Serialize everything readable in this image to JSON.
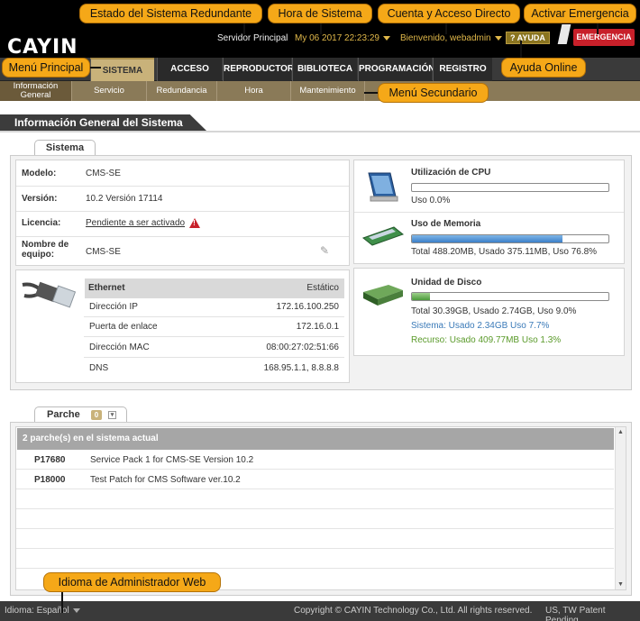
{
  "header": {
    "logo_text": "CAYIN",
    "server": "Servidor Principal",
    "datetime": "My 06 2017 22:23:29",
    "welcome": "Bienvenido, webadmin",
    "help": "AYUDA",
    "emergency": "EMERGENCIA"
  },
  "main_menu": [
    "SISTEMA",
    "ACCESO",
    "REPRODUCTOR",
    "BIBLIOTECA",
    "PROGRAMACIÓN",
    "REGISTRO"
  ],
  "sub_menu": [
    "Información General",
    "Servicio",
    "Redundancia",
    "Hora",
    "Mantenimiento"
  ],
  "callouts": {
    "redundant": "Estado del Sistema Redundante",
    "system_time": "Hora de Sistema",
    "account": "Cuenta y Acceso Directo",
    "emergency": "Activar Emergencia",
    "main_menu": "Menú Principal",
    "online_help": "Ayuda Online",
    "sub_menu": "Menú Secundario",
    "language": "Idioma de Administrador Web"
  },
  "page_title": "Información General del Sistema",
  "system": {
    "tab": "Sistema",
    "model_label": "Modelo:",
    "model": "CMS-SE",
    "version_label": "Versión:",
    "version": "10.2 Versión 17114",
    "license_label": "Licencia:",
    "license": "Pendiente a ser activado",
    "name_label": "Nombre de equipo:",
    "name": "CMS-SE"
  },
  "ethernet": {
    "title": "Ethernet",
    "mode": "Estático",
    "rows": [
      {
        "k": "Dirección IP",
        "v": "172.16.100.250"
      },
      {
        "k": "Puerta de enlace",
        "v": "172.16.0.1"
      },
      {
        "k": "Dirección MAC",
        "v": "08:00:27:02:51:66"
      },
      {
        "k": "DNS",
        "v": "168.95.1.1, 8.8.8.8"
      }
    ]
  },
  "resources": {
    "cpu_title": "Utilización de CPU",
    "cpu_text": "Uso 0.0%",
    "cpu_pct": 0.0,
    "mem_title": "Uso de Memoria",
    "mem_text": "Total 488.20MB, Usado 375.11MB, Uso 76.8%",
    "mem_pct": 76.8,
    "disk_title": "Unidad de Disco",
    "disk_text": "Total 30.39GB, Usado 2.74GB, Uso 9.0%",
    "disk_pct": 9.0,
    "disk_system": "Sistema: Usado 2.34GB Uso 7.7%",
    "disk_resource": "Recurso: Usado 409.77MB Uso 1.3%"
  },
  "patch": {
    "tab": "Parche",
    "count": "0",
    "header": "2 parche(s) en el sistema actual",
    "rows": [
      {
        "id": "P17680",
        "desc": "Service Pack 1 for CMS-SE Version 10.2"
      },
      {
        "id": "P18000",
        "desc": "Test Patch for CMS Software ver.10.2"
      }
    ]
  },
  "footer": {
    "lang_label": "Idioma:",
    "lang": "Español",
    "copyright": "Copyright © CAYIN Technology Co., Ltd. All rights reserved.",
    "patent": "US, TW Patent Pending"
  },
  "colors": {
    "accent": "#f5a818",
    "emergency": "#c8202a",
    "submenu": "#8a7a58",
    "bar": "#3c7fc8"
  }
}
